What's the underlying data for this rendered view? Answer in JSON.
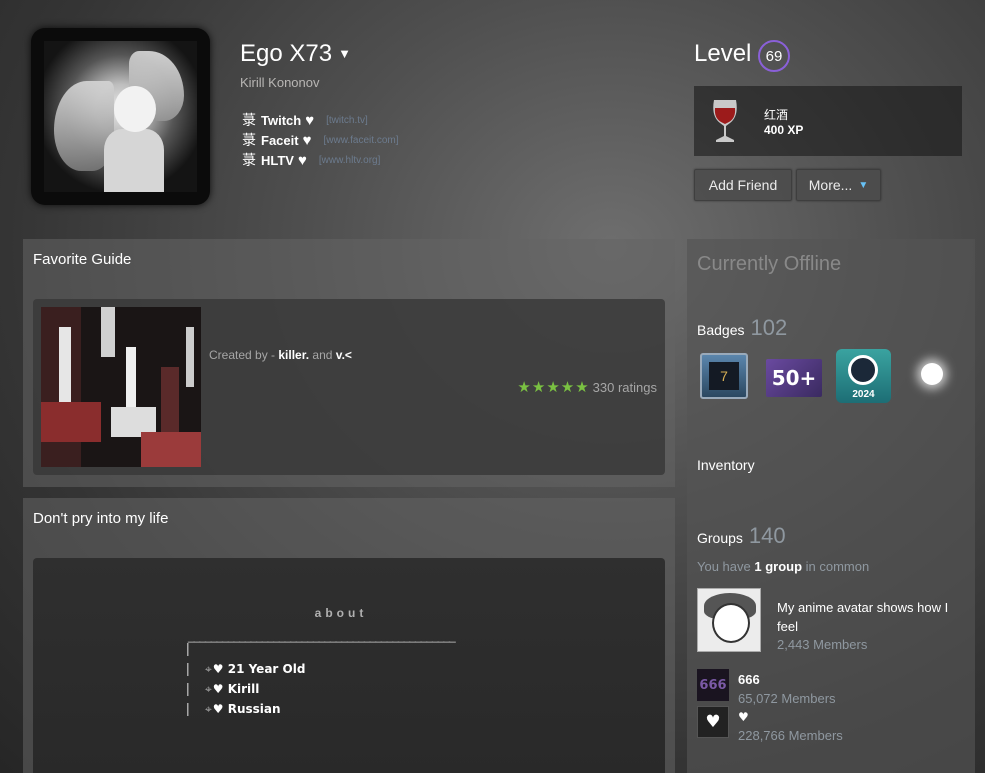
{
  "profile": {
    "persona_name": "Ego X73",
    "name_caret": "▼",
    "real_name": "Kirill Kononov",
    "links": [
      {
        "glyph": "菉",
        "label": "Twitch",
        "heart": "♥",
        "url": "[twitch.tv]"
      },
      {
        "glyph": "菉",
        "label": "Faceit",
        "heart": "♥",
        "url": "[www.faceit.com]"
      },
      {
        "glyph": "菉",
        "label": "HLTV",
        "heart": "♥",
        "url": "[www.hltv.org]"
      }
    ]
  },
  "level": {
    "label": "Level",
    "value": "69"
  },
  "favorite_badge": {
    "name": "红酒",
    "xp": "400 XP",
    "icon": "wine-glass-icon"
  },
  "buttons": {
    "add_friend": "Add Friend",
    "more": "More...",
    "more_caret": "▼"
  },
  "guide_section": {
    "title": "Favorite Guide",
    "created_prefix": "Created by - ",
    "author_1": "killer.",
    "and": " and ",
    "author_2": "v.<",
    "stars": "★★★★★",
    "ratings": "330 ratings"
  },
  "about_section": {
    "title": "Don't pry into my life",
    "heading": "about",
    "rule": "_______________________________________________",
    "pipe": "|",
    "ornament": "⌖",
    "heart": "♥",
    "lines": [
      "21 Year Old",
      "Kirill",
      "Russian"
    ]
  },
  "sidebar": {
    "status": "Currently Offline",
    "badges_label": "Badges",
    "badges_count": "102",
    "badge_1_value": "7",
    "badge_2_value": "50+",
    "badge_3_year": "2024",
    "inventory_label": "Inventory",
    "groups_label": "Groups",
    "groups_count": "140",
    "groups_common_prefix": "You have ",
    "groups_common_bold": "1 group",
    "groups_common_suffix": " in common",
    "groups": [
      {
        "name": "My anime avatar shows how I feel",
        "members": "2,443 Members"
      },
      {
        "name": "666",
        "members": "65,072 Members",
        "avatar_text": "666"
      },
      {
        "name": "♥",
        "members": "228,766 Members",
        "avatar_text": "♥"
      }
    ]
  },
  "colors": {
    "level_ring": "#8a60d8",
    "stars": "#7ac142",
    "link_blue": "#67c1f5"
  }
}
